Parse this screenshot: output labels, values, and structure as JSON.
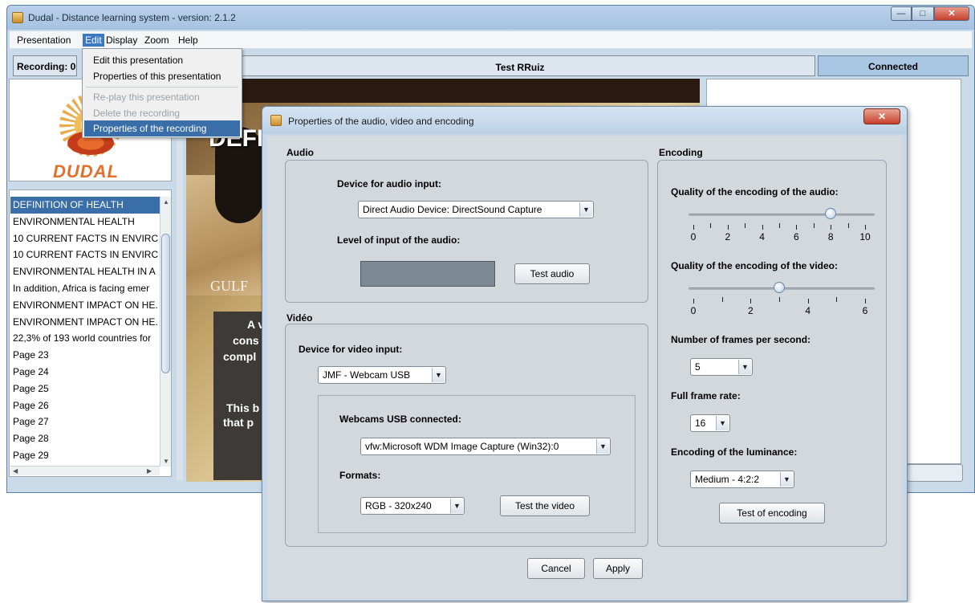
{
  "main_window": {
    "title": "Dudal - Distance learning system - version: 2.1.2",
    "menu": [
      "Presentation",
      "Edit",
      "Display",
      "Zoom",
      "Help"
    ],
    "recording_label": "Recording: 00",
    "presentation_title": "Test RRuiz",
    "connection_status": "Connected",
    "logo_text": "DUDAL"
  },
  "edit_menu": {
    "items": [
      {
        "label": "Edit this presentation",
        "state": "enabled"
      },
      {
        "label": "Properties of this presentation",
        "state": "enabled"
      },
      {
        "label": "Re-play this presentation",
        "state": "disabled"
      },
      {
        "label": "Delete the recording",
        "state": "disabled"
      },
      {
        "label": "Properties of the recording",
        "state": "selected"
      }
    ]
  },
  "slides_list": [
    "DEFINITION OF HEALTH",
    "ENVIRONMENTAL HEALTH",
    "10 CURRENT FACTS IN ENVIRC",
    "10 CURRENT FACTS IN ENVIRC",
    "ENVIRONMENTAL HEALTH IN A",
    "In addition, Africa is facing emer",
    "ENVIRONMENT IMPACT ON HE.",
    "ENVIRONMENT IMPACT ON HE.",
    "22,3% of 193 world countries for",
    "Page 23",
    "Page 24",
    "Page 25",
    "Page 26",
    "Page 27",
    "Page 28",
    "Page 29"
  ],
  "slide": {
    "heading": "DEFI",
    "gulf": "GULF",
    "line1": "A v",
    "line2": "cons",
    "line3": "compl",
    "line4": "This b",
    "line5": "that p"
  },
  "dialog": {
    "title": "Properties of the audio, video and encoding",
    "audio": {
      "section_label": "Audio",
      "device_label": "Device for audio input:",
      "device_value": "Direct Audio Device: DirectSound Capture",
      "level_label": "Level of input of the audio:",
      "test_button": "Test audio"
    },
    "video": {
      "section_label": "Vidéo",
      "device_label": "Device for video input:",
      "device_value": "JMF - Webcam USB",
      "webcams_label": "Webcams USB connected:",
      "webcam_value": "vfw:Microsoft WDM Image Capture (Win32):0",
      "formats_label": "Formats:",
      "format_value": "RGB - 320x240",
      "test_button": "Test the video"
    },
    "encoding": {
      "section_label": "Encoding",
      "audio_quality_label": "Quality of the encoding of the audio:",
      "audio_quality_value": 8,
      "audio_quality_range": [
        0,
        10
      ],
      "audio_ticks": [
        "0",
        "2",
        "4",
        "6",
        "8",
        "10"
      ],
      "video_quality_label": "Quality of the encoding of the video:",
      "video_quality_value": 3,
      "video_quality_range": [
        0,
        6
      ],
      "video_ticks": [
        "0",
        "2",
        "4",
        "6"
      ],
      "fps_label": "Number of frames per second:",
      "fps_value": "5",
      "full_rate_label": "Full frame rate:",
      "full_rate_value": "16",
      "luminance_label": "Encoding of the luminance:",
      "luminance_value": "Medium - 4:2:2",
      "test_button": "Test of encoding"
    },
    "cancel_button": "Cancel",
    "apply_button": "Apply"
  }
}
